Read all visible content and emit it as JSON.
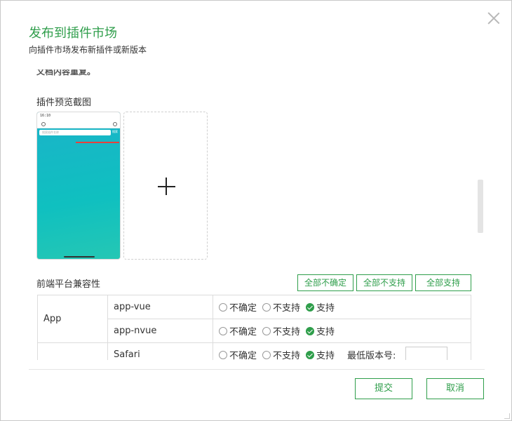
{
  "dialog": {
    "title": "发布到插件市场",
    "subtitle": "向插件市场发布新插件或新版本"
  },
  "content": {
    "cut_text": "文档内容重复。",
    "preview_label": "插件预览截图",
    "preview_image": {
      "status_time": "16:10",
      "search_placeholder": "搜索插件名称",
      "search_button": "搜索"
    },
    "compat_label": "前端平台兼容性",
    "bulk_buttons": {
      "all_uncertain": "全部不确定",
      "all_unsupported": "全部不支持",
      "all_supported": "全部支持"
    },
    "options": {
      "uncertain": "不确定",
      "unsupported": "不支持",
      "supported": "支持"
    },
    "rows": [
      {
        "group": "App",
        "platform": "app-vue",
        "selected": "supported"
      },
      {
        "group": "",
        "platform": "app-nvue",
        "selected": "supported"
      },
      {
        "group": "",
        "platform": "Safari",
        "selected": "supported",
        "min_version_label": "最低版本号:"
      }
    ]
  },
  "footer": {
    "submit": "提交",
    "cancel": "取消"
  },
  "colors": {
    "accent": "#2f9e4b",
    "border": "#dcdcdc"
  }
}
